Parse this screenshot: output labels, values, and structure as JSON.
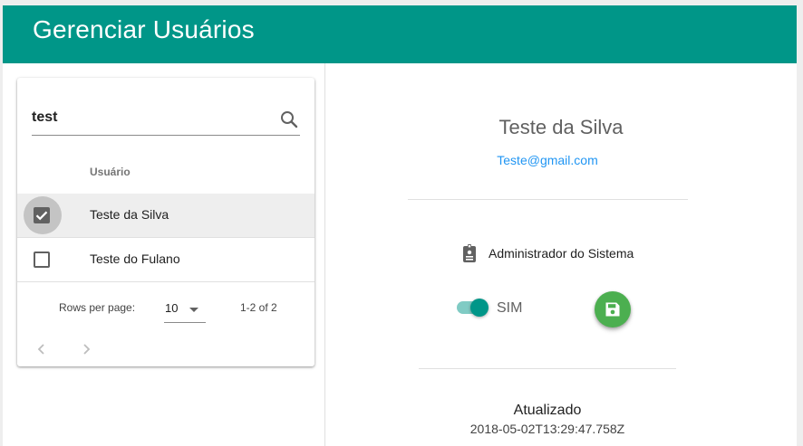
{
  "app": {
    "title": "Gerenciar Usuários",
    "accent": "#009688"
  },
  "search": {
    "value": "test",
    "icon": "search-icon"
  },
  "table": {
    "column_header": "Usuário",
    "rows": [
      {
        "name": "Teste da Silva",
        "checked": true,
        "selected": true
      },
      {
        "name": "Teste do Fulano",
        "checked": false,
        "selected": false
      }
    ]
  },
  "pagination": {
    "rows_per_page_label": "Rows per page:",
    "rows_per_page_value": "10",
    "range_label": "1-2 of 2",
    "prev_icon": "chevron-left-icon",
    "next_icon": "chevron-right-icon"
  },
  "detail": {
    "name": "Teste da Silva",
    "email": "Teste@gmail.com",
    "role": "Administrador do Sistema",
    "role_icon": "badge-icon",
    "active_toggle": {
      "on": true,
      "label": "SIM"
    },
    "save_icon": "floppy-disk-icon",
    "save_color": "#4caf50",
    "updated_label": "Atualizado",
    "updated_value": "2018-05-02T13:29:47.758Z",
    "email_color": "#2196f3"
  }
}
